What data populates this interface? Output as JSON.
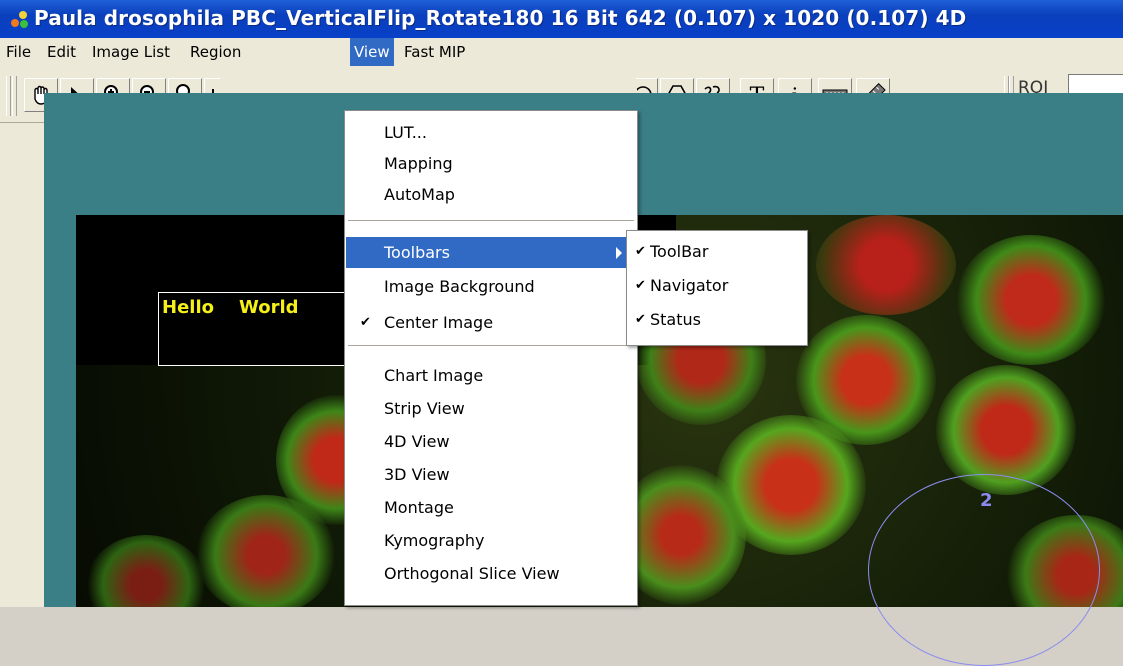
{
  "window": {
    "title": "Paula drosophila PBC_VerticalFlip_Rotate180 16 Bit 642 (0.107) x 1020 (0.107) 4D",
    "icon": "app-icon"
  },
  "menubar": {
    "items": [
      {
        "label": "File"
      },
      {
        "label": "Edit"
      },
      {
        "label": "Image List"
      },
      {
        "label": "Region"
      },
      {
        "label": "View"
      },
      {
        "label": "Fast MIP"
      }
    ],
    "active": "View"
  },
  "toolbar": {
    "tools": [
      "hand-tool-icon",
      "arrow-pointer-icon",
      "zoom-in-icon",
      "zoom-out-icon",
      "zoom-reset-icon",
      "crosshair-icon",
      "circle-roi-icon",
      "polygon-roi-icon",
      "freehand-roi-icon",
      "text-tool-icon",
      "info-tool-icon",
      "ruler-icon",
      "measure-icon"
    ],
    "roi_label": "ROI"
  },
  "view_menu": {
    "items": [
      {
        "label": "LUT...",
        "checked": false
      },
      {
        "label": "Mapping",
        "checked": false
      },
      {
        "label": "AutoMap",
        "checked": false
      },
      {
        "label": "Toolbars",
        "checked": false,
        "submenu": true,
        "highlighted": true
      },
      {
        "label": "Image Background",
        "checked": false
      },
      {
        "label": "Center Image",
        "checked": true
      },
      {
        "label": "Chart Image",
        "checked": false
      },
      {
        "label": "Strip View",
        "checked": false
      },
      {
        "label": "4D View",
        "checked": false
      },
      {
        "label": "3D View",
        "checked": false
      },
      {
        "label": "Montage",
        "checked": false
      },
      {
        "label": "Kymography",
        "checked": false
      },
      {
        "label": "Orthogonal Slice View",
        "checked": false
      }
    ]
  },
  "toolbars_submenu": {
    "items": [
      {
        "label": "ToolBar",
        "checked": true
      },
      {
        "label": "Navigator",
        "checked": true
      },
      {
        "label": "Status",
        "checked": true
      }
    ]
  },
  "canvas": {
    "text_roi": "Hello    World",
    "circle_roi_number": "2"
  },
  "colors": {
    "title_bar": "#0a3fbd",
    "menu_highlight": "#316ac5",
    "roi_text": "#f5f01a",
    "roi_circle": "#8c8cf0"
  }
}
